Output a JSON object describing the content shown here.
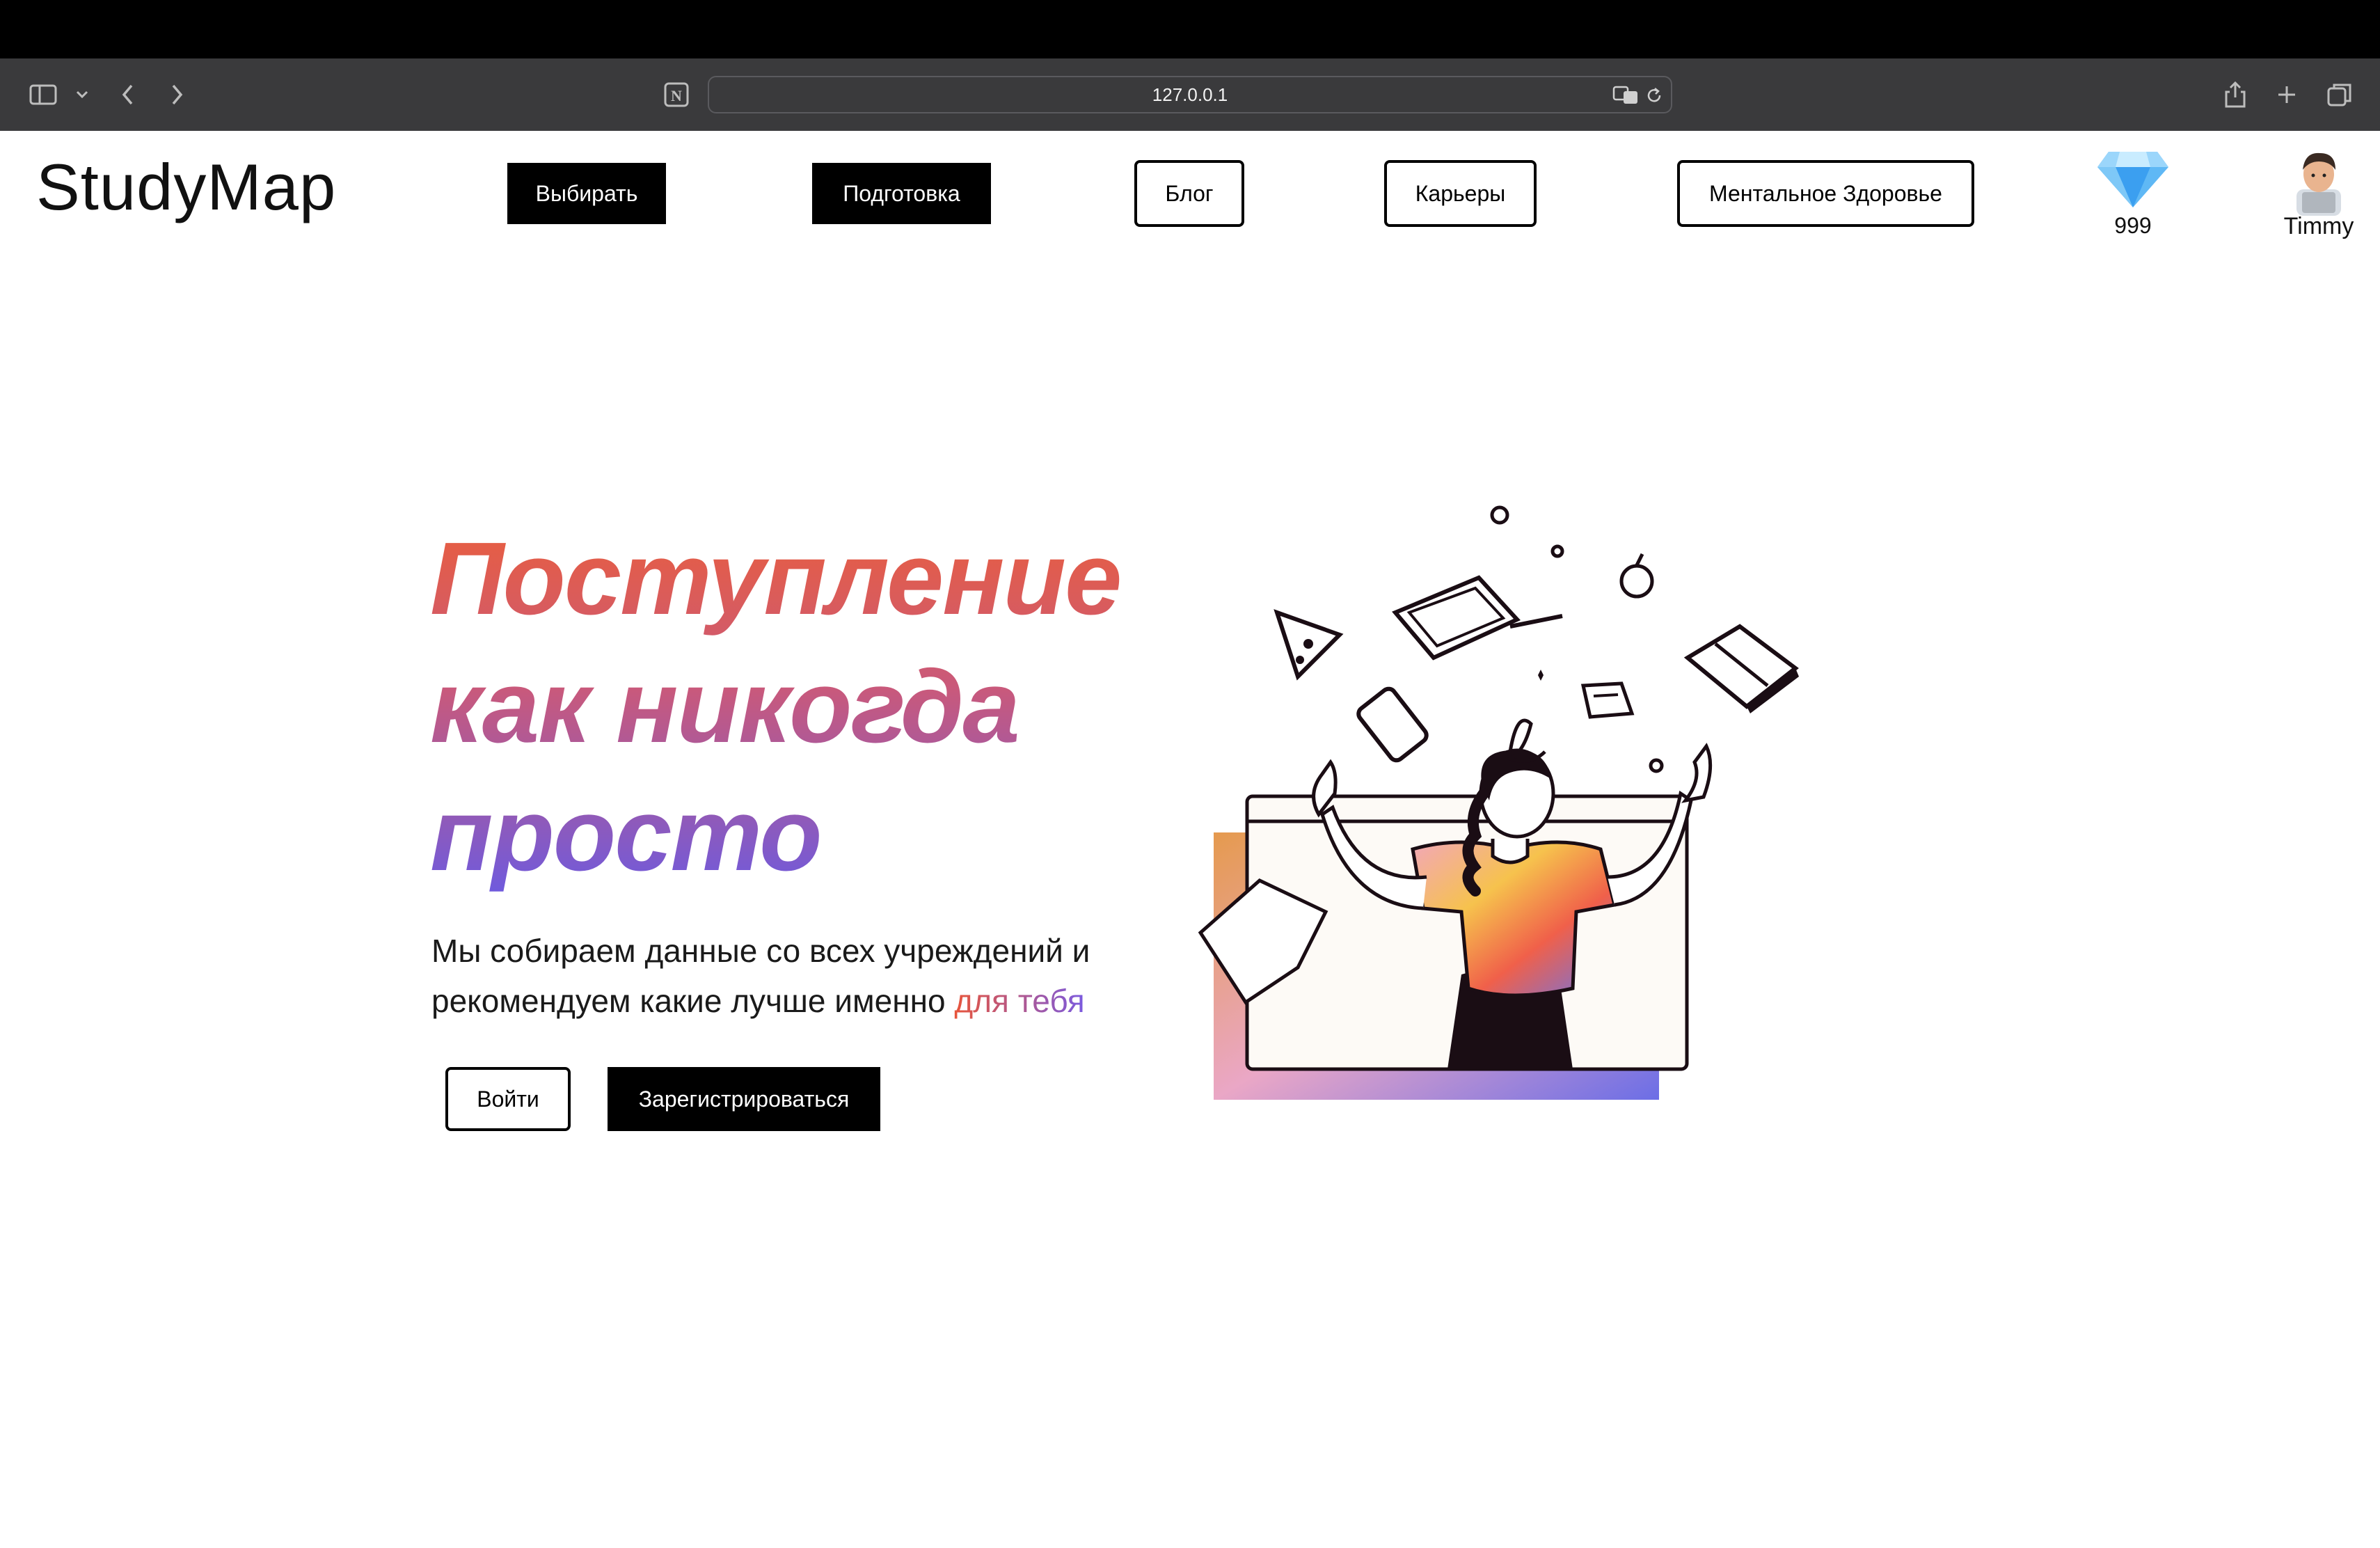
{
  "browser": {
    "url": "127.0.0.1",
    "icons": [
      "sidebar-icon",
      "chevron-down-icon",
      "back-icon",
      "forward-icon",
      "notion-icon",
      "translate-icon",
      "reload-icon",
      "share-icon",
      "new-tab-icon",
      "tabs-icon"
    ]
  },
  "header": {
    "logo": "StudyMap",
    "nav": [
      {
        "label": "Выбирать",
        "style": "dark"
      },
      {
        "label": "Подготовка",
        "style": "dark"
      },
      {
        "label": "Блог",
        "style": "outline"
      },
      {
        "label": "Карьеры",
        "style": "outline"
      },
      {
        "label": "Ментальное Здоровье",
        "style": "outline"
      }
    ],
    "gems": "999",
    "user_name": "Timmy"
  },
  "hero": {
    "title_lines": [
      "Поступление",
      "как никогда",
      "просто"
    ],
    "subtitle_line1": "Мы собираем данные со всех учреждений и",
    "subtitle_line2": "рекомендуем какие лучше именно ",
    "subtitle_accent": "для тебя",
    "login_label": "Войти",
    "register_label": "Зарегистрироваться"
  },
  "colors": {
    "gradient_start": "#ea5e3c",
    "gradient_mid": "#c9597b",
    "gradient_end": "#6c5ae0",
    "browser_chrome": "#3a3a3c"
  }
}
